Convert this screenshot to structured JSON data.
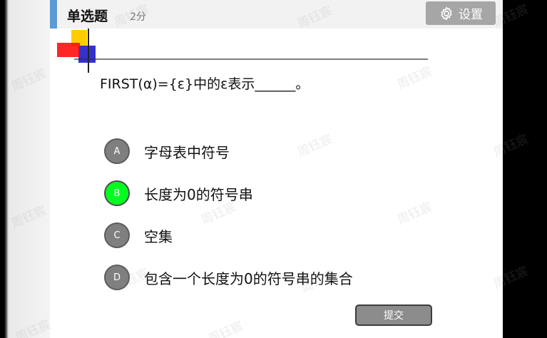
{
  "header": {
    "question_type": "单选题",
    "score": "2分",
    "settings_label": "设置"
  },
  "question": {
    "text": "FIRST(α)={ε}中的ε表示______。"
  },
  "options": [
    {
      "letter": "A",
      "text": "字母表中符号",
      "selected": false
    },
    {
      "letter": "B",
      "text": "长度为0的符号串",
      "selected": true
    },
    {
      "letter": "C",
      "text": "空集",
      "selected": false
    },
    {
      "letter": "D",
      "text": "包含一个长度为0的符号串的集合",
      "selected": false
    }
  ],
  "submit_label": "提交",
  "watermark_text": "周钰宸",
  "colors": {
    "header_accent": "#5b9bd5",
    "selected_option": "#00ff1f",
    "option_default": "#7f7f7f",
    "settings_button": "#a6a6a6",
    "submit_button": "#8c8c8c"
  },
  "icons": {
    "settings": "gear-icon"
  }
}
